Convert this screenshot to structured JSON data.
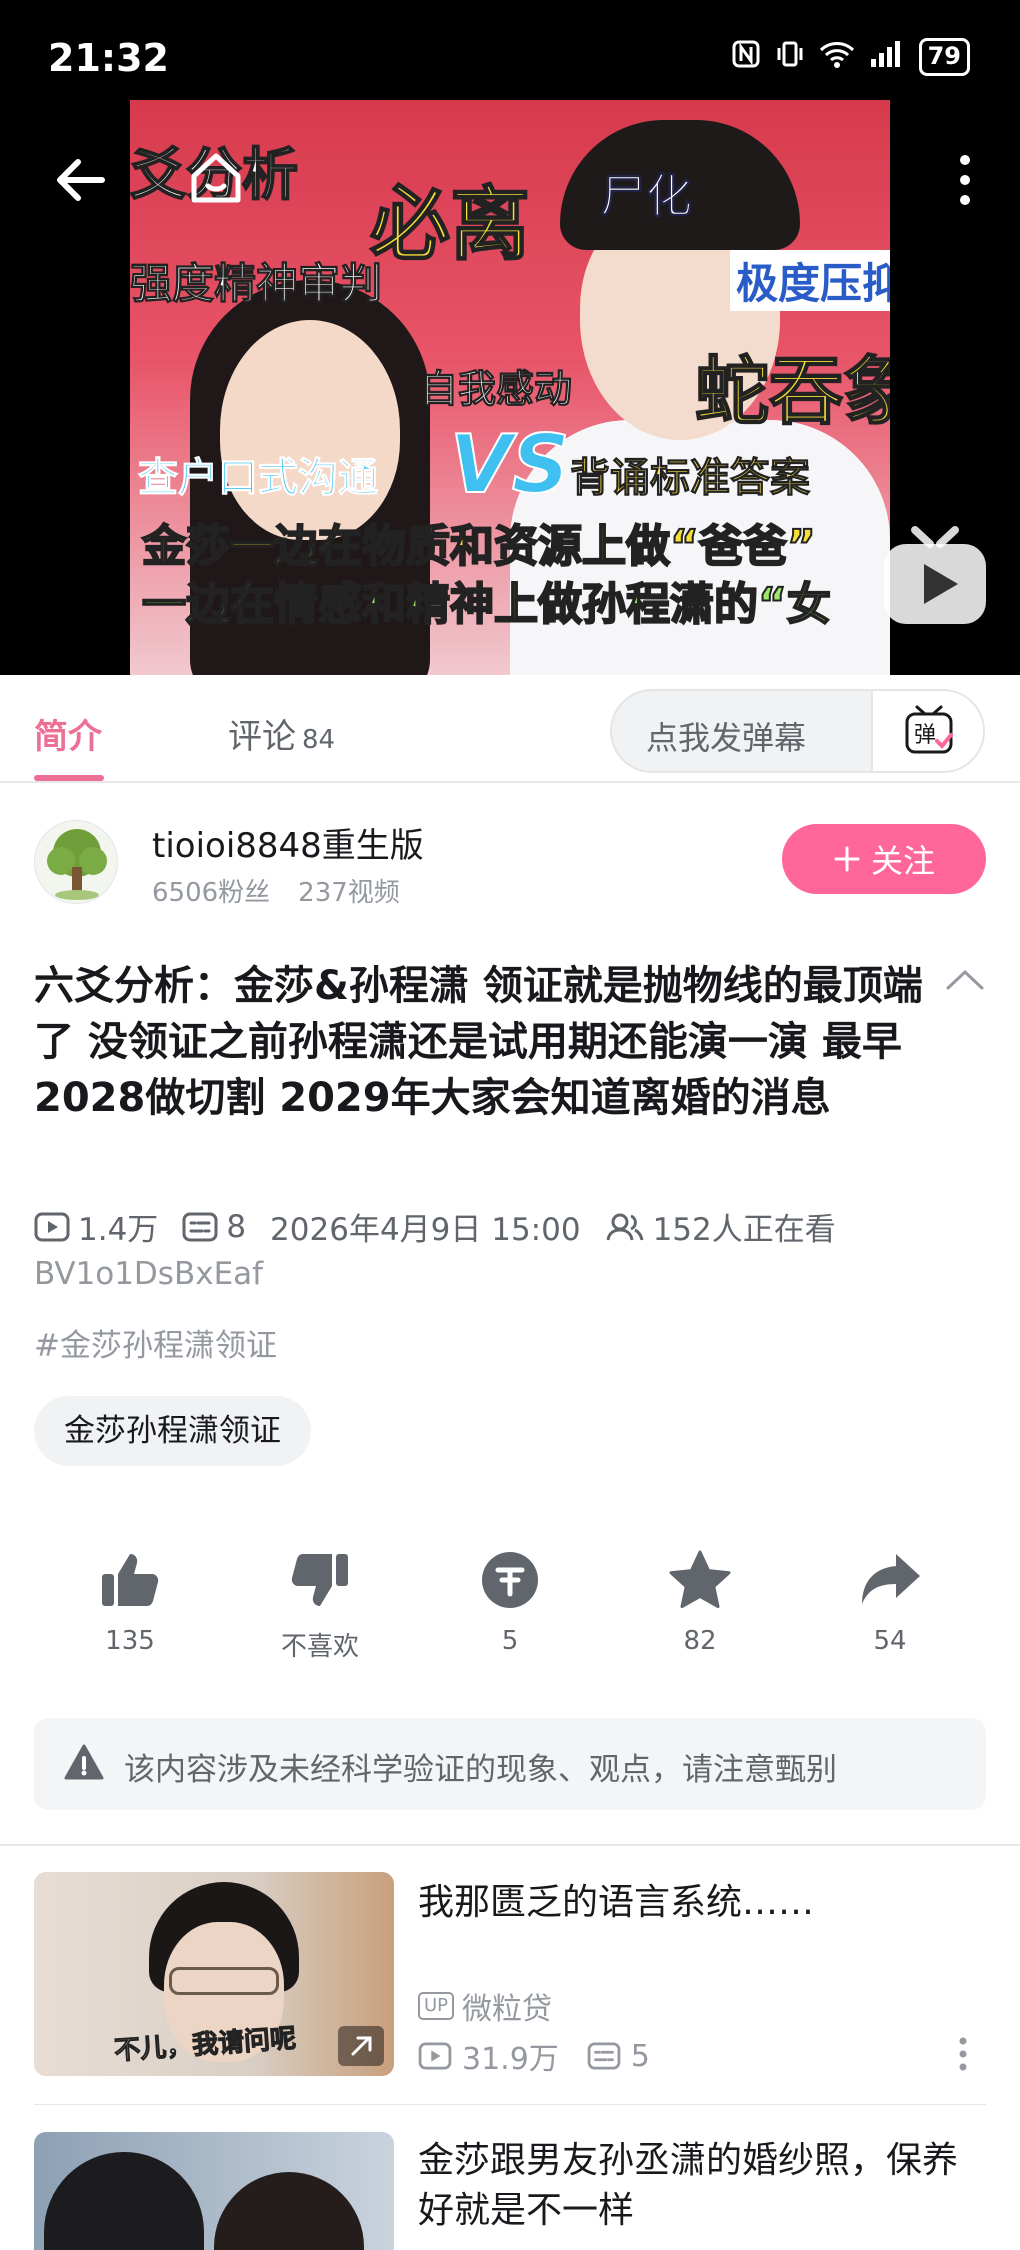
{
  "status_bar": {
    "time": "21:32",
    "battery": "79"
  },
  "video": {
    "thumbnail_text": {
      "t1": "爻分析",
      "t2": "必离",
      "t3": "尸化",
      "t4": "强度精神审判",
      "t5": "极度压抑",
      "t6": "自我感动",
      "t7": "蛇吞象",
      "t8": "查户口式沟通",
      "t9": "VS",
      "t10": "背诵标准答案",
      "t11": "金莎一边在物质和资源上做“爸爸”",
      "t12": "一边在情感和精神上做孙程潇的“女"
    },
    "icons": [
      "back-arrow-icon",
      "home-icon",
      "more-vertical-icon",
      "play-icon"
    ]
  },
  "tabs": {
    "intro_label": "简介",
    "comment_label": "评论",
    "comment_count": "84",
    "danmaku_placeholder": "点我发弹幕",
    "danmaku_button": "弹"
  },
  "uploader": {
    "name": "tioioi8848重生版",
    "fans": "6506粉丝",
    "videos": "237视频",
    "follow_label": "关注"
  },
  "video_info": {
    "title": "六爻分析：金莎&孙程潇 领证就是抛物线的最顶端了 没领证之前孙程潇还是试用期还能演一演 最早2028做切割 2029年大家会知道离婚的消息",
    "views": "1.4万",
    "danmaku_count": "8",
    "publish_time": "2026年4月9日 15:00",
    "watching": "152人正在看",
    "bvid": "BV1o1DsBxEaf",
    "hashtag": "#金莎孙程潇领证",
    "tag_chip": "金莎孙程潇领证"
  },
  "actions": [
    {
      "icon": "thumb-up-icon",
      "label": "135"
    },
    {
      "icon": "thumb-down-icon",
      "label": "不喜欢"
    },
    {
      "icon": "coin-icon",
      "label": "5"
    },
    {
      "icon": "star-icon",
      "label": "82"
    },
    {
      "icon": "share-icon",
      "label": "54"
    }
  ],
  "notice": "该内容涉及未经科学验证的现象、观点，请注意甄别",
  "recommendations": [
    {
      "title": "我那匮乏的语言系统……",
      "thumb_subtitle": "不儿，我请问呢",
      "up_badge": "UP",
      "uploader": "微粒贷",
      "views": "31.9万",
      "danmaku": "5"
    },
    {
      "title": "金莎跟男友孙丞潇的婚纱照，保养好就是不一样"
    }
  ],
  "colors": {
    "accent": "#ff6699",
    "tab_active": "#ec6f95",
    "text_primary": "#18191c",
    "text_secondary": "#61666d",
    "text_muted": "#9499a0"
  }
}
